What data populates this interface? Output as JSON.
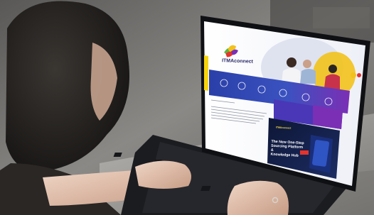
{
  "scene": {
    "logo_text": "ITMAconnect",
    "brand_small": "ITMAconnect",
    "headline": "The New One-Stop\nSourcing Platform &\nKnowledge Hub"
  },
  "colors": {
    "banner_blue": "#2a3fa8",
    "banner_purple": "#7b2fb5",
    "logo_green": "#5ab443",
    "logo_yellow": "#f2c21b",
    "logo_red": "#e4332d",
    "sidebar_yellow": "#f6d40d",
    "promo_dark": "#101a3a"
  },
  "icons": [
    "logo-icon",
    "hand-icon",
    "laptop-icon",
    "keyboard-icon"
  ]
}
